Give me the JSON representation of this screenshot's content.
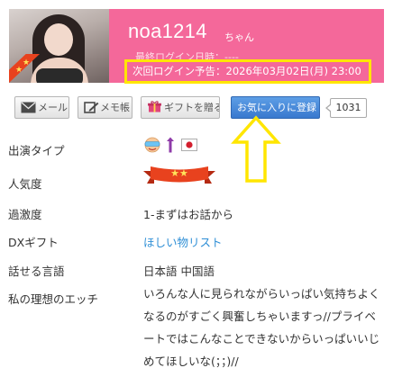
{
  "profile": {
    "username": "noa1214",
    "honorific": "ちゃん",
    "last_login": "最終ログイン日時：----",
    "next_login": "次回ログイン予告：2026年03月02日(月) 23:00",
    "rank_badge": "★★"
  },
  "actions": {
    "mail_label": "メール",
    "memo_label": "メモ帳",
    "gift_label": "ギフトを贈る",
    "favorite_label": "お気に入りに登録",
    "favorite_count": "1031"
  },
  "details": {
    "type_label": "出演タイプ",
    "type_icons": [
      "face-mask-icon",
      "exclamation-icon",
      "japan-flag-icon"
    ],
    "popularity_label": "人気度",
    "popularity_stars": "★★",
    "radical_label": "過激度",
    "radical_value": "1-まずはお話から",
    "dx_gift_label": "DXギフト",
    "dx_gift_link": "ほしい物リスト",
    "language_label": "話せる言語",
    "language_value": "日本語 中国語",
    "ideal_label": "私の理想のエッチ",
    "ideal_text": "いろんな人に見られながらいっぱい気持ちよくなるのがすごく興奮しちゃいますっ//プライベートではこんなことできないからいっぱいいじめてほしいな(；；)//"
  },
  "colors": {
    "header_pink": "#f4689a",
    "highlight_yellow": "#ffe600",
    "favorite_blue": "#3979cf",
    "link_blue": "#2f8fd6",
    "ribbon_red": "#e8421e"
  }
}
